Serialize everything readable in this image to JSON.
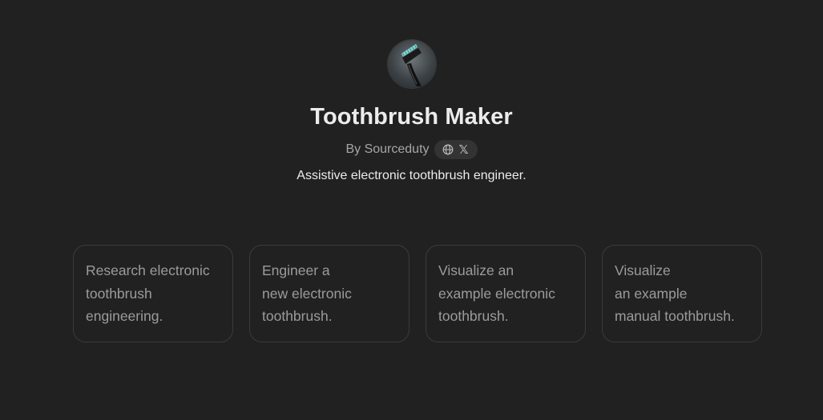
{
  "gpt": {
    "avatar_icon": "toothbrush-avatar-icon",
    "name": "Toothbrush Maker",
    "byline": "By Sourceduty",
    "social_icons": [
      "globe-icon",
      "x-icon"
    ],
    "x_glyph": "𝕏",
    "description": "Assistive electronic toothbrush engineer."
  },
  "conversation_starters": [
    {
      "text": "Research electronic\ntoothbrush\nengineering."
    },
    {
      "text": "Engineer a\nnew electronic\ntoothbrush."
    },
    {
      "text": "Visualize an\nexample electronic\ntoothbrush."
    },
    {
      "text": "Visualize\nan example\nmanual toothbrush."
    }
  ],
  "colors": {
    "background": "#212121",
    "title": "#ececec",
    "muted_text": "#a6a6a6",
    "card_border": "#3b3b3b",
    "card_text": "#9b9b9b",
    "pill_background": "#333333",
    "bristle_accent": "#7fd6d3"
  }
}
